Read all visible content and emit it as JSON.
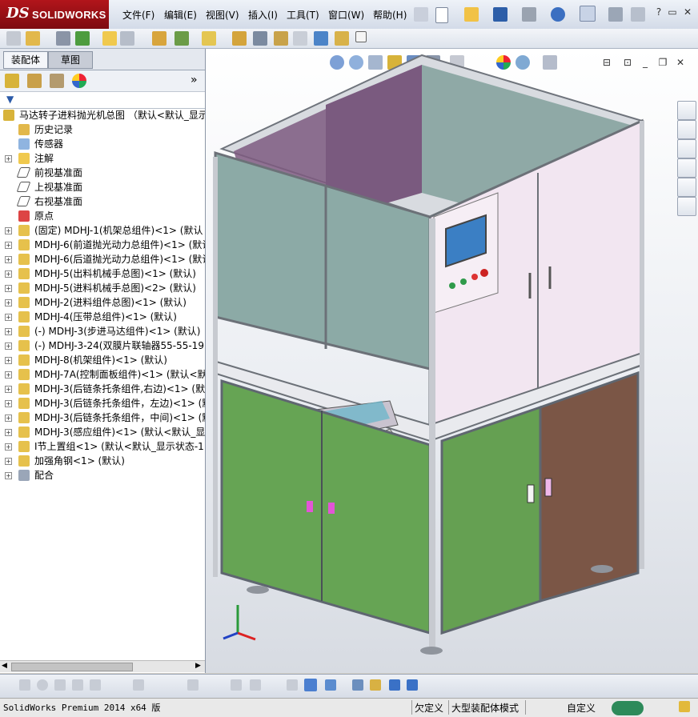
{
  "app": {
    "logo_ds": "DS",
    "logo_text": "SOLIDWORKS"
  },
  "menu": [
    "文件(F)",
    "编辑(E)",
    "视图(V)",
    "插入(I)",
    "工具(T)",
    "窗口(W)",
    "帮助(H)"
  ],
  "tabs": {
    "assembly": "装配体",
    "sketch": "草图"
  },
  "tree": {
    "root": "马达转子进料抛光机总图 （默认<默认_显示",
    "items": [
      {
        "label": "历史记录",
        "type": "history"
      },
      {
        "label": "传感器",
        "type": "sensor"
      },
      {
        "label": "注解",
        "type": "annotation"
      },
      {
        "label": "前视基准面",
        "type": "plane"
      },
      {
        "label": "上视基准面",
        "type": "plane"
      },
      {
        "label": "右视基准面",
        "type": "plane"
      },
      {
        "label": "原点",
        "type": "origin"
      },
      {
        "label": "(固定) MDHJ-1(机架总组件)<1> (默认",
        "type": "asm"
      },
      {
        "label": "MDHJ-6(前道抛光动力总组件)<1> (默认",
        "type": "asm"
      },
      {
        "label": "MDHJ-6(后道抛光动力总组件)<1> (默认",
        "type": "asm"
      },
      {
        "label": "MDHJ-5(出料机械手总图)<1> (默认)",
        "type": "asm"
      },
      {
        "label": "MDHJ-5(进料机械手总图)<2> (默认)",
        "type": "asm"
      },
      {
        "label": "MDHJ-2(进料组件总图)<1> (默认)",
        "type": "asm"
      },
      {
        "label": "MDHJ-4(压带总组件)<1> (默认)",
        "type": "asm"
      },
      {
        "label": "(-) MDHJ-3(步进马达组件)<1> (默认)",
        "type": "asm"
      },
      {
        "label": "(-) MDHJ-3-24(双膜片联轴器55-55-19)",
        "type": "asm"
      },
      {
        "label": "MDHJ-8(机架组件)<1> (默认)",
        "type": "asm"
      },
      {
        "label": "MDHJ-7A(控制面板组件)<1> (默认<默认",
        "type": "asm"
      },
      {
        "label": "MDHJ-3(后链条托条组件,右边)<1> (默",
        "type": "asm"
      },
      {
        "label": "MDHJ-3(后链条托条组件，左边)<1> (默",
        "type": "asm"
      },
      {
        "label": "MDHJ-3(后链条托条组件，中间)<1> (默",
        "type": "asm"
      },
      {
        "label": "MDHJ-3(感应组件)<1> (默认<默认_显示",
        "type": "asm"
      },
      {
        "label": "I节上置组<1> (默认<默认_显示状态-1>",
        "type": "asm"
      },
      {
        "label": "加强角钢<1> (默认)",
        "type": "asm"
      },
      {
        "label": "配合",
        "type": "mates"
      }
    ]
  },
  "status": {
    "version": "SolidWorks Premium 2014 x64 版",
    "define": "欠定义",
    "mode": "大型装配体模式",
    "custom": "自定义"
  },
  "colors": {
    "logo": "#9f1218",
    "green_door": "#63a051",
    "brown_door": "#7a5545",
    "pink_panel": "#f1e4f0",
    "glass": "#8aa8a3",
    "frame": "#c9ccd2"
  }
}
